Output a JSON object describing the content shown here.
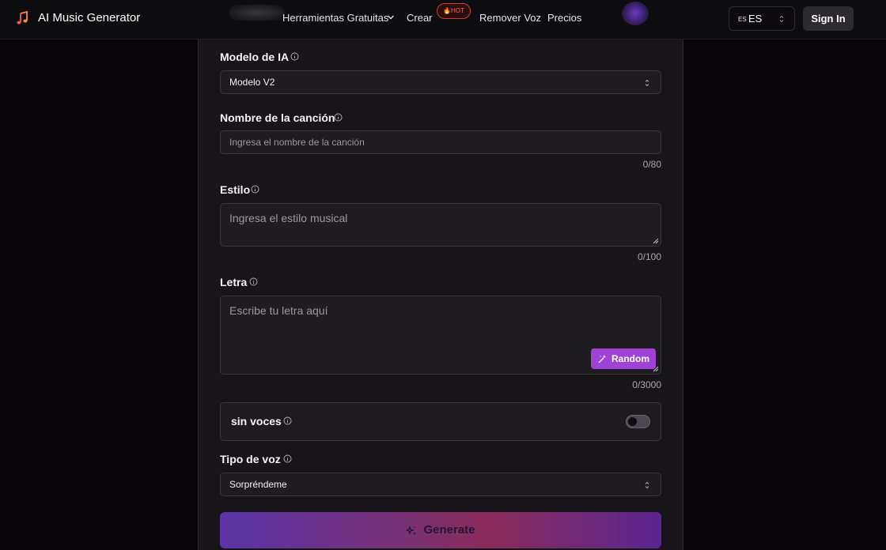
{
  "header": {
    "brand": "AI Music Generator",
    "nav": {
      "tools": "Herramientas Gratuitas",
      "create": "Crear",
      "hot_badge": "🔥HOT",
      "remove_voice": "Remover Voz",
      "prices": "Precios"
    },
    "language": {
      "flag": "ES",
      "code": "ES"
    },
    "sign_in": "Sign In"
  },
  "form": {
    "model": {
      "label": "Modelo de IA",
      "value": "Modelo V2"
    },
    "song_name": {
      "label": "Nombre de la canción",
      "placeholder": "Ingresa el nombre de la canción",
      "counter": "0/80"
    },
    "style": {
      "label": "Estilo",
      "placeholder": "Ingresa el estilo musical",
      "counter": "0/100"
    },
    "lyrics": {
      "label": "Letra",
      "placeholder": "Escribe tu letra aquí",
      "counter": "0/3000",
      "random_button": "Random"
    },
    "instrumental": {
      "label": "sin voces",
      "enabled": false
    },
    "voice_type": {
      "label": "Tipo de voz",
      "value": "Sorpréndeme"
    },
    "generate_button": "Generate"
  },
  "colors": {
    "accent": "#9f43d6",
    "hot": "#ff6262",
    "background": "#070507",
    "panel": "#17151a"
  }
}
